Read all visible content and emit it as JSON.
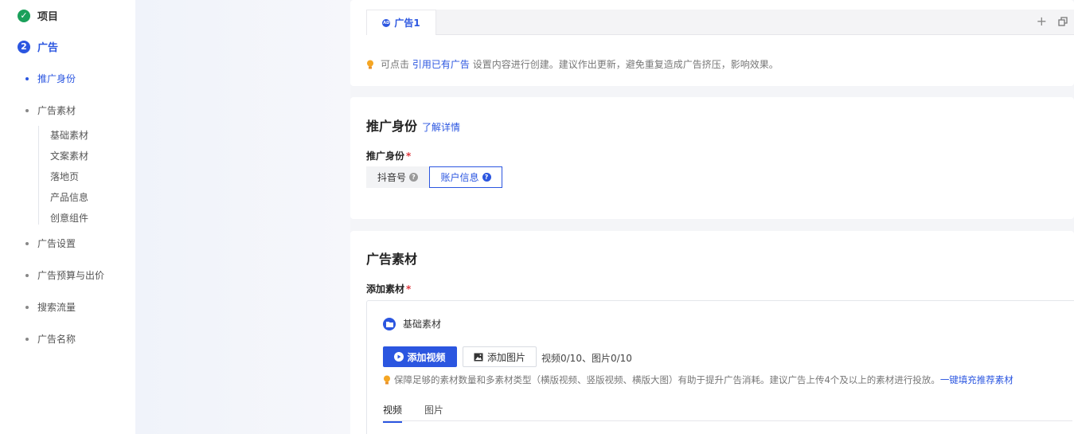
{
  "sidebar": {
    "stages": [
      {
        "label": "项目",
        "badge": "✓",
        "state": "done"
      },
      {
        "label": "广告",
        "badge": "2",
        "state": "active"
      }
    ],
    "items": [
      {
        "label": "推广身份"
      },
      {
        "label": "广告素材"
      },
      {
        "label": "广告设置"
      },
      {
        "label": "广告预算与出价"
      },
      {
        "label": "搜索流量"
      },
      {
        "label": "广告名称"
      }
    ],
    "sub_items": [
      {
        "label": "基础素材"
      },
      {
        "label": "文案素材"
      },
      {
        "label": "落地页"
      },
      {
        "label": "产品信息"
      },
      {
        "label": "创意组件"
      }
    ]
  },
  "ad_tabs": {
    "active_label": "广告1",
    "ad_badge": "AD",
    "add_symbol": "+"
  },
  "tip": {
    "prefix": "可点击",
    "link": "引用已有广告",
    "suffix": "设置内容进行创建。建议作出更新，避免重复造成广告挤压，影响效果。"
  },
  "identity": {
    "title": "推广身份",
    "more_link": "了解详情",
    "field_label": "推广身份",
    "required_mark": "*",
    "options": [
      {
        "label": "抖音号",
        "help": "?"
      },
      {
        "label": "账户信息",
        "help": "?"
      }
    ]
  },
  "material": {
    "title": "广告素材",
    "field_label": "添加素材",
    "required_mark": "*",
    "section_label": "基础素材",
    "add_video": "添加视频",
    "add_image": "添加图片",
    "count": "视频0/10、图片0/10",
    "tip_text": "保障足够的素材数量和多素材类型（横版视频、竖版视频、横版大图）有助于提升广告消耗。建议广告上传4个及以上的素材进行投放。",
    "tip_link": "一键填充推荐素材",
    "tabs": [
      {
        "label": "视频"
      },
      {
        "label": "图片"
      }
    ]
  },
  "colors": {
    "primary": "#2b56e0",
    "success": "#1aa05a",
    "required": "#e0383e"
  }
}
